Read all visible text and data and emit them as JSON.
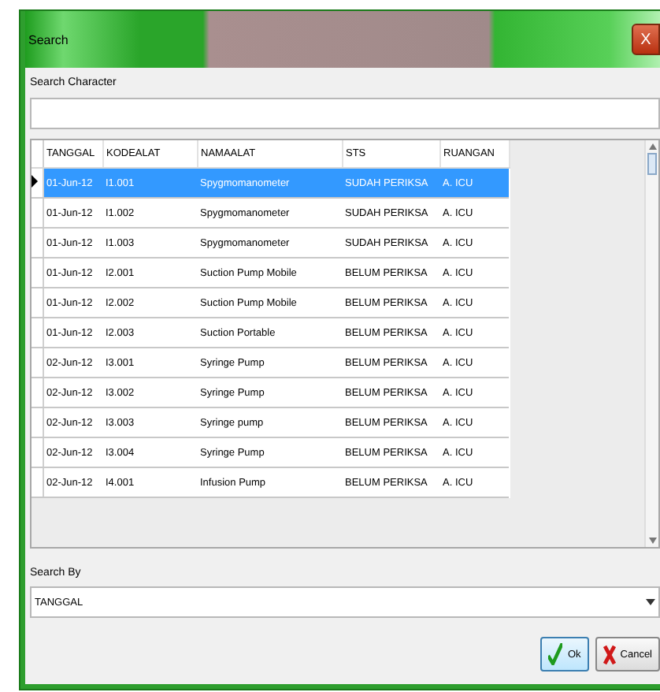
{
  "window": {
    "title": "Search",
    "close": "X"
  },
  "search_character": {
    "label": "Search Character"
  },
  "table": {
    "columns": [
      "TANGGAL",
      "KODEALAT",
      "NAMAALAT",
      "STS",
      "RUANGAN"
    ],
    "rows": [
      {
        "cells": [
          "01-Jun-12",
          "I1.001",
          "Spygmomanometer",
          "SUDAH PERIKSA",
          "A. ICU"
        ],
        "selected": true
      },
      {
        "cells": [
          "01-Jun-12",
          "I1.002",
          "Spygmomanometer",
          "SUDAH PERIKSA",
          "A. ICU"
        ],
        "selected": false
      },
      {
        "cells": [
          "01-Jun-12",
          "I1.003",
          "Spygmomanometer",
          "SUDAH PERIKSA",
          "A. ICU"
        ],
        "selected": false
      },
      {
        "cells": [
          "01-Jun-12",
          "I2.001",
          "Suction Pump Mobile",
          "BELUM PERIKSA",
          "A. ICU"
        ],
        "selected": false
      },
      {
        "cells": [
          "01-Jun-12",
          "I2.002",
          "Suction Pump Mobile",
          "BELUM PERIKSA",
          "A. ICU"
        ],
        "selected": false
      },
      {
        "cells": [
          "01-Jun-12",
          "I2.003",
          "Suction Portable",
          "BELUM PERIKSA",
          "A. ICU"
        ],
        "selected": false
      },
      {
        "cells": [
          "02-Jun-12",
          "I3.001",
          "Syringe Pump",
          "BELUM PERIKSA",
          "A. ICU"
        ],
        "selected": false
      },
      {
        "cells": [
          "02-Jun-12",
          "I3.002",
          "Syringe Pump",
          "BELUM PERIKSA",
          "A. ICU"
        ],
        "selected": false
      },
      {
        "cells": [
          "02-Jun-12",
          "I3.003",
          "Syringe pump",
          "BELUM PERIKSA",
          "A. ICU"
        ],
        "selected": false
      },
      {
        "cells": [
          "02-Jun-12",
          "I3.004",
          "Syringe Pump",
          "BELUM PERIKSA",
          "A. ICU"
        ],
        "selected": false
      },
      {
        "cells": [
          "02-Jun-12",
          "I4.001",
          "Infusion Pump",
          "BELUM PERIKSA",
          "A. ICU"
        ],
        "selected": false
      }
    ]
  },
  "search_by": {
    "label": "Search By",
    "value": "TANGGAL"
  },
  "buttons": [
    {
      "kind": "ok",
      "label": "Ok"
    },
    {
      "kind": "cancel",
      "label": "Cancel"
    }
  ]
}
